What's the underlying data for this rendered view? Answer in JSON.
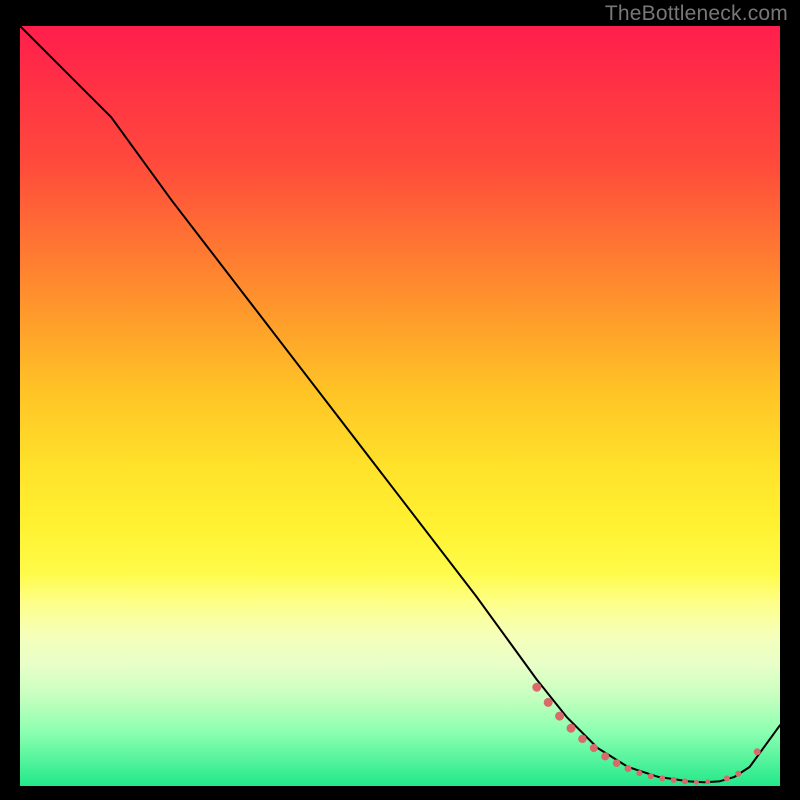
{
  "watermark": "TheBottleneck.com",
  "chart_data": {
    "type": "line",
    "title": "",
    "xlabel": "",
    "ylabel": "",
    "xlim": [
      0,
      100
    ],
    "ylim": [
      0,
      100
    ],
    "series": [
      {
        "name": "curve",
        "x": [
          0,
          8,
          12,
          20,
          30,
          40,
          50,
          60,
          68,
          72,
          76,
          80,
          84,
          88,
          90,
          92,
          94,
          96,
          100
        ],
        "y": [
          100,
          92,
          88,
          77,
          64,
          51,
          38,
          25,
          14,
          9,
          5,
          2.5,
          1.2,
          0.6,
          0.5,
          0.6,
          1.2,
          2.5,
          8
        ]
      }
    ],
    "markers": [
      {
        "x": 68.0,
        "y": 13.0,
        "r": 4.5
      },
      {
        "x": 69.5,
        "y": 11.0,
        "r": 4.5
      },
      {
        "x": 71.0,
        "y": 9.2,
        "r": 4.5
      },
      {
        "x": 72.5,
        "y": 7.6,
        "r": 4.5
      },
      {
        "x": 74.0,
        "y": 6.2,
        "r": 4.2
      },
      {
        "x": 75.5,
        "y": 5.0,
        "r": 4.0
      },
      {
        "x": 77.0,
        "y": 3.9,
        "r": 4.0
      },
      {
        "x": 78.5,
        "y": 3.0,
        "r": 3.8
      },
      {
        "x": 80.0,
        "y": 2.3,
        "r": 3.5
      },
      {
        "x": 81.5,
        "y": 1.7,
        "r": 3.0
      },
      {
        "x": 83.0,
        "y": 1.3,
        "r": 3.0
      },
      {
        "x": 84.5,
        "y": 1.0,
        "r": 3.0
      },
      {
        "x": 86.0,
        "y": 0.8,
        "r": 3.0
      },
      {
        "x": 87.5,
        "y": 0.6,
        "r": 3.0
      },
      {
        "x": 89.0,
        "y": 0.5,
        "r": 2.5
      },
      {
        "x": 90.5,
        "y": 0.55,
        "r": 2.5
      },
      {
        "x": 93.0,
        "y": 1.0,
        "r": 3.0
      },
      {
        "x": 94.5,
        "y": 1.6,
        "r": 3.0
      },
      {
        "x": 97.0,
        "y": 4.5,
        "r": 3.5
      }
    ],
    "marker_color": "#d86a6a",
    "line_color": "#000000"
  }
}
